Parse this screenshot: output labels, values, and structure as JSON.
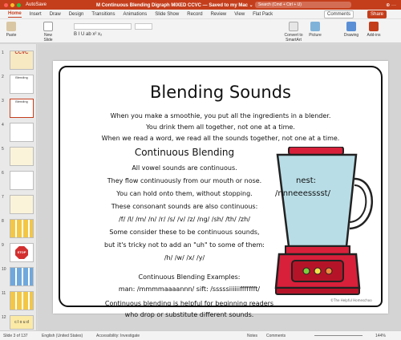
{
  "titlebar": {
    "autosave": "AutoSave",
    "doc_title": "M Continuous Blending Digraph  MIXED CCVC — Saved to my Mac ⌄",
    "search_placeholder": "Search (Cmd + Ctrl + U)",
    "right": "⊕ ···"
  },
  "tabs": [
    "Home",
    "Insert",
    "Draw",
    "Design",
    "Transitions",
    "Animations",
    "Slide Show",
    "Record",
    "Review",
    "View",
    "Flat Pack"
  ],
  "tab_buttons": {
    "comments": "Comments",
    "share": "Share"
  },
  "ribbon": {
    "paste": "Paste",
    "new_slide": "New Slide",
    "convert": "Convert to SmartArt",
    "picture": "Picture",
    "drawing": "Drawing",
    "addins": "Add-ins",
    "format_row": "B  I  U  ab  x²  x₂"
  },
  "thumbnails": [
    {
      "num": "1",
      "text": "CCVC"
    },
    {
      "num": "2",
      "text": "Blending"
    },
    {
      "num": "3",
      "text": "Blending"
    },
    {
      "num": "4",
      "text": ""
    },
    {
      "num": "5",
      "text": ""
    },
    {
      "num": "6",
      "text": ""
    },
    {
      "num": "7",
      "text": ""
    },
    {
      "num": "8",
      "text": ""
    },
    {
      "num": "9",
      "text": "STOP"
    },
    {
      "num": "10",
      "text": ""
    },
    {
      "num": "11",
      "text": ""
    },
    {
      "num": "12",
      "text": "c l o u d"
    }
  ],
  "slide": {
    "title": "Blending Sounds",
    "intro": [
      "When you make a smoothie, you put all the ingredients in a blender.",
      "You drink them all together, not one at a time.",
      "When we read a word, we read all the sounds together, not one at a time."
    ],
    "heading": "Continuous Blending",
    "body": [
      "All vowel sounds are continuous.",
      "They flow continuously from our mouth or nose.",
      "You can hold onto them, without stopping.",
      "These consonant sounds are also continuous:",
      "/f/  /l/  /m/  /n/  /r/  /s/  /v/  /z/  /ng/  /sh/  /th/  /zh/",
      "Some consider these to be continuous sounds,",
      "but it's tricky not to add an \"uh\" to some of them:",
      "/h/   /w/   /x/   /y/"
    ],
    "examples_heading": "Continuous Blending Examples:",
    "examples": "man:  /mmmmaaaannn/     sift: /sssssiiiiiiffffffft/",
    "closing": [
      "Continuous blending is helpful for beginning readers",
      "who drop or substitute different sounds."
    ],
    "blender_word": "nest:",
    "blender_sound": "/nnneeesssst/",
    "credit": "©The Helpful Homeschoo"
  },
  "status": {
    "slide": "Slide 3 of 137",
    "language": "English (United States)",
    "accessibility": "Accessibility: Investigate",
    "notes": "Notes",
    "comments": "Comments",
    "zoom": "144%"
  },
  "colors": {
    "accent": "#c43e1c",
    "blender_red": "#d8203a",
    "blender_glass": "#b8dde6"
  }
}
